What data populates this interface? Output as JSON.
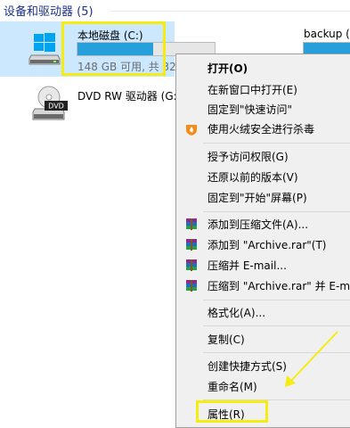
{
  "section": {
    "title": "设备和驱动器 (5)"
  },
  "drives": [
    {
      "name": "本地磁盘 (C:)",
      "info": "148 GB 可用, 共 32",
      "fill_fraction": 0.55
    },
    {
      "name": "DVD RW 驱动器 (G:",
      "icon_label": "DVD"
    },
    {
      "name": "backup (",
      "fill_fraction": 1.0
    }
  ],
  "context_menu": {
    "items": [
      {
        "label": "打开(O)",
        "bold": true
      },
      {
        "label": "在新窗口中打开(E)"
      },
      {
        "label": "固定到\"快速访问\""
      },
      {
        "label": "使用火绒安全进行杀毒",
        "icon": "huorong-flame-icon"
      },
      {
        "label": "授予访问权限(G)"
      },
      {
        "label": "还原以前的版本(V)"
      },
      {
        "label": "固定到\"开始\"屏幕(P)"
      },
      {
        "label": "添加到压缩文件(A)...",
        "icon": "winrar-icon"
      },
      {
        "label": "添加到 \"Archive.rar\"(T)",
        "icon": "winrar-icon"
      },
      {
        "label": "压缩并 E-mail...",
        "icon": "winrar-icon"
      },
      {
        "label": "压缩到 \"Archive.rar\" 并 E-mail",
        "icon": "winrar-icon"
      },
      {
        "label": "格式化(A)..."
      },
      {
        "label": "复制(C)"
      },
      {
        "label": "创建快捷方式(S)"
      },
      {
        "label": "重命名(M)"
      },
      {
        "label": "属性(R)"
      }
    ]
  },
  "colors": {
    "accent": "#26a0da",
    "selection": "#cce8ff",
    "annotation": "#f5ec12",
    "header_text": "#1e3287"
  }
}
